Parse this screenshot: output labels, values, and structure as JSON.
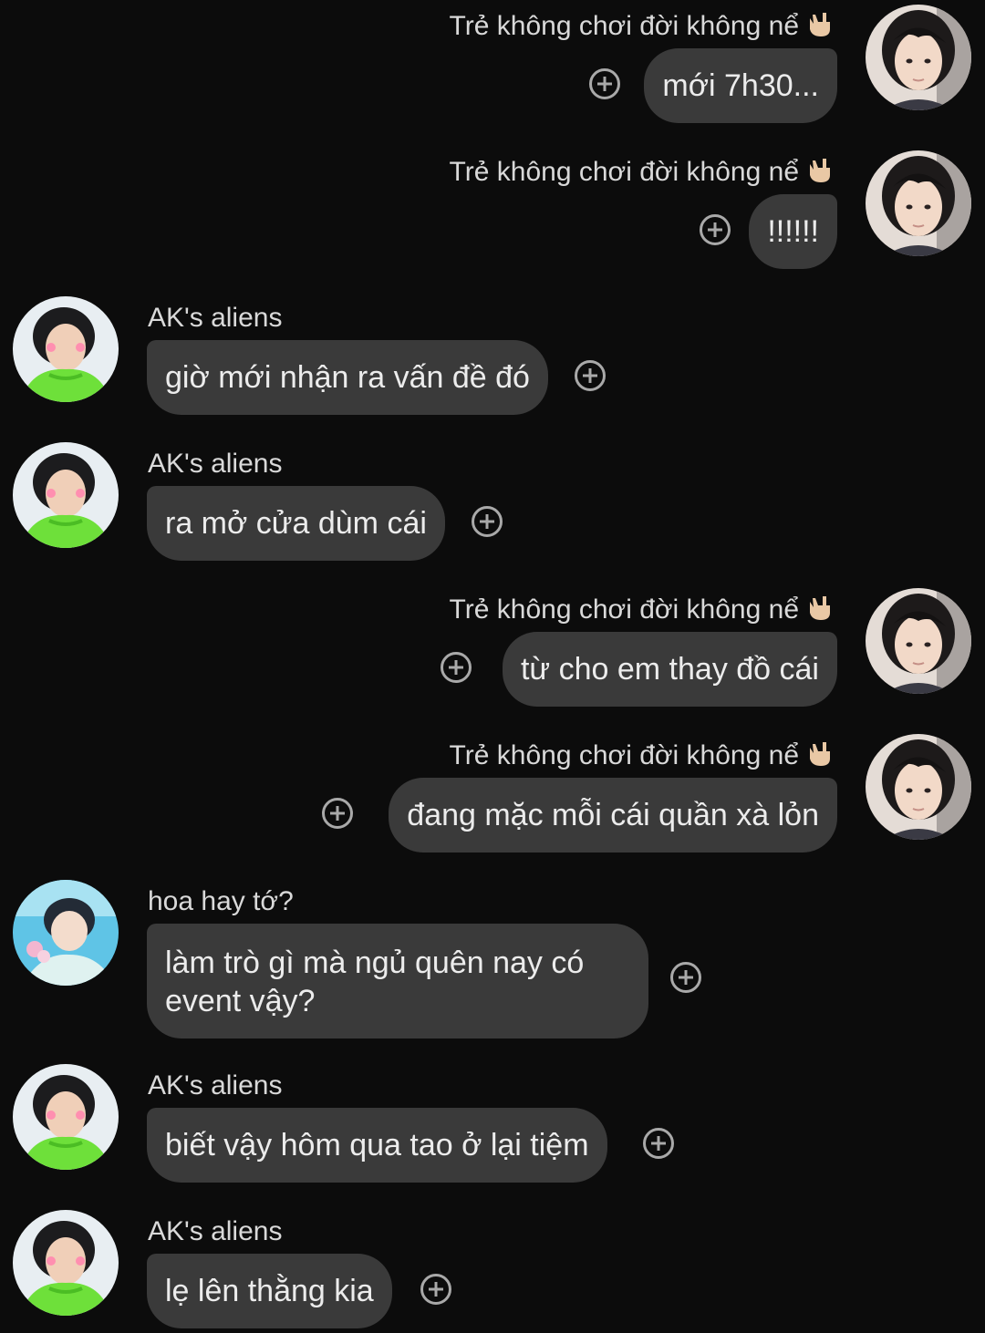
{
  "app": {
    "background": "#0c0c0c",
    "bubble_color": "#3a3a3a",
    "react_icon": "add-reaction-circle-plus"
  },
  "messages": [
    {
      "side": "right",
      "sender": "Trẻ không chơi đời không nể",
      "sender_emoji": "rock-hand-emoji",
      "text": "mới 7h30...",
      "avatar": "avatar-boy-dark-hair"
    },
    {
      "side": "right",
      "sender": "Trẻ không chơi đời không nể",
      "sender_emoji": "rock-hand-emoji",
      "text": "!!!!!!",
      "avatar": "avatar-boy-dark-hair"
    },
    {
      "side": "left",
      "sender": "AK's aliens",
      "text": "giờ mới nhận ra vấn đề đó",
      "avatar": "avatar-green-shirt"
    },
    {
      "side": "left",
      "sender": "AK's aliens",
      "text": "ra mở cửa dùm cái",
      "avatar": "avatar-green-shirt"
    },
    {
      "side": "right",
      "sender": "Trẻ không chơi đời không nể",
      "sender_emoji": "rock-hand-emoji",
      "text": "từ cho em thay đồ cái",
      "avatar": "avatar-boy-dark-hair"
    },
    {
      "side": "right",
      "sender": "Trẻ không chơi đời không nể",
      "sender_emoji": "rock-hand-emoji",
      "text": "đang mặc mỗi cái quần xà lỏn",
      "avatar": "avatar-boy-dark-hair"
    },
    {
      "side": "left",
      "sender": "hoa hay tớ?",
      "text": "làm trò gì mà ngủ quên nay có event vậy?",
      "avatar": "avatar-pool-boy"
    },
    {
      "side": "left",
      "sender": "AK's aliens",
      "text": "biết vậy hôm qua tao ở lại tiệm",
      "avatar": "avatar-green-shirt"
    },
    {
      "side": "left",
      "sender": "AK's aliens",
      "text": "lẹ lên thằng kia",
      "avatar": "avatar-green-shirt"
    }
  ]
}
